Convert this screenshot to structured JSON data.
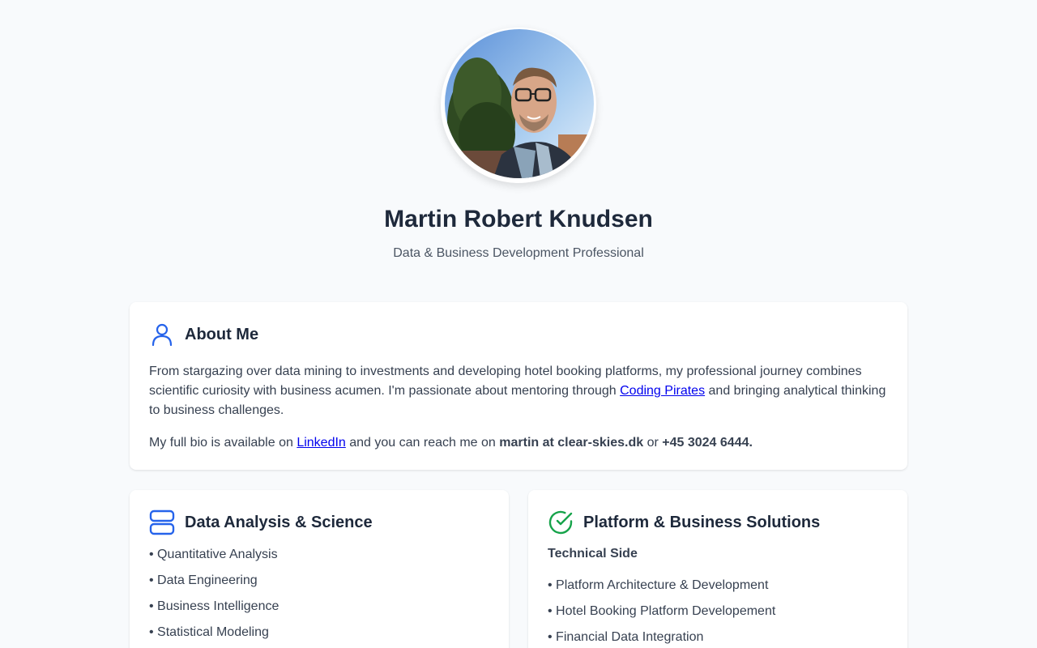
{
  "profile": {
    "name": "Martin Robert Knudsen",
    "tagline": "Data & Business Development Professional"
  },
  "about": {
    "title": "About Me",
    "icon": "user-icon",
    "paragraph1_before": "From stargazing over data mining to investments and developing hotel booking platforms, my professional journey combines scientific curiosity with business acumen. I'm passionate about mentoring through ",
    "paragraph1_link": "Coding Pirates",
    "paragraph1_after": " and bringing analytical thinking to business challenges.",
    "paragraph2_before": "My full bio is available on ",
    "paragraph2_link": "LinkedIn",
    "paragraph2_middle": " and you can reach me on ",
    "email": "martin at clear-skies.dk",
    "paragraph2_or": " or ",
    "phone": "+45 3024 6444."
  },
  "data_card": {
    "title": "Data Analysis & Science",
    "icon": "database-icon",
    "items": [
      "• Quantitative Analysis",
      "• Data Engineering",
      "• Business Intelligence",
      "• Statistical Modeling"
    ]
  },
  "platform_card": {
    "title": "Platform & Business Solutions",
    "icon": "check-circle-icon",
    "subheading": "Technical Side",
    "items": [
      "• Platform Architecture & Development",
      "• Hotel Booking Platform Developement",
      "• Financial Data Integration"
    ]
  },
  "colors": {
    "accent_blue": "#2563eb",
    "accent_green": "#16a34a",
    "background": "#f8fafc"
  }
}
